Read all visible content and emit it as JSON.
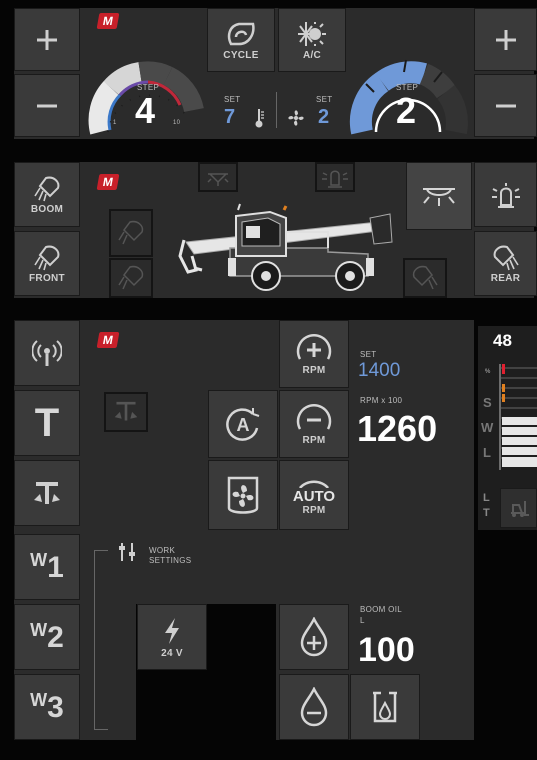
{
  "colors": {
    "background": "#050505",
    "panel": "#2b2b2b",
    "button": "#3a3a3a",
    "accent_blue": "#6f99d8",
    "brand_red": "#c8202a"
  },
  "brand": {
    "logo_letter": "M"
  },
  "climate": {
    "plus_icon": "plus-icon",
    "minus_icon": "minus-icon",
    "cycle_label": "CYCLE",
    "ac_label": "A/C",
    "heat": {
      "step_label": "STEP",
      "value": "4",
      "scale_min": "1",
      "scale_max": "10",
      "set_label": "SET",
      "set_value": "7"
    },
    "fan": {
      "step_label": "STEP",
      "value": "2",
      "set_label": "SET",
      "set_value": "2"
    }
  },
  "lights": {
    "boom_label": "BOOM",
    "front_label": "FRONT",
    "rear_label": "REAR"
  },
  "machine": {
    "rpm_plus_label": "RPM",
    "rpm_minus_label": "RPM",
    "auto_label": "AUTO",
    "auto_rpm_label": "RPM",
    "set_label": "SET",
    "set_value": "1400",
    "rpm_caption": "RPM x 100",
    "rpm_value": "1260",
    "work_settings_label": "WORK\nSETTINGS",
    "voltage_label": "24 V",
    "boom_oil_label": "BOOM OIL",
    "boom_oil_unit": "L",
    "boom_oil_value": "100",
    "t_label": "T",
    "w1_label": "W",
    "w1_num": "1",
    "w2_label": "W",
    "w2_num": "2",
    "w3_label": "W",
    "w3_num": "3"
  },
  "gauge": {
    "value": "48",
    "pct_label": "%",
    "letters": [
      "S",
      "W",
      "L"
    ],
    "lt_l": "L",
    "lt_t": "T"
  }
}
